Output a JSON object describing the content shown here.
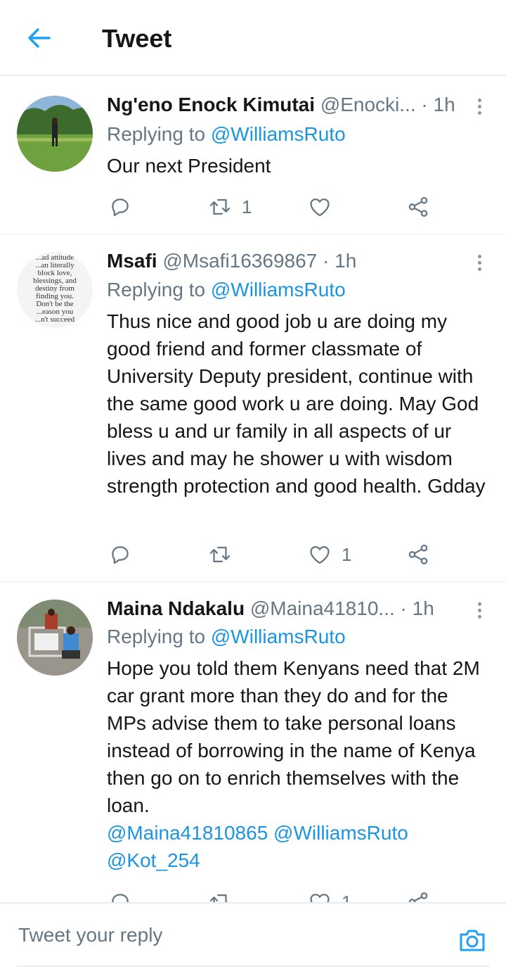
{
  "header": {
    "title": "Tweet"
  },
  "tweets": [
    {
      "name": "Ng'eno Enock Kimutai",
      "handle": "@Enocki...",
      "time": "· 1h",
      "reply_prefix": "Replying to ",
      "reply_handle": "@WilliamsRuto",
      "text": "Our next President",
      "retweet_count": "1",
      "like_count": ""
    },
    {
      "name": "Msafi",
      "handle": "@Msafi16369867",
      "time": "· 1h",
      "reply_prefix": "Replying to ",
      "reply_handle": "@WilliamsRuto",
      "text": "Thus nice and good job u are doing my good friend and former classmate of University Deputy president, continue with the same good work u are doing. May God bless u and ur family in all aspects of ur lives and may he shower u with wisdom strength protection and good health. Gdday",
      "retweet_count": "",
      "like_count": "1",
      "avatar_text": [
        "...ad attitude",
        "...an literally",
        "block love,",
        "blessings, and",
        "destiny from",
        "finding you.",
        "Don't be the",
        "...eason you",
        "...n't succeed"
      ]
    },
    {
      "name": "Maina Ndakalu",
      "handle": "@Maina41810...",
      "time": "· 1h",
      "reply_prefix": "Replying to ",
      "reply_handle": "@WilliamsRuto",
      "text": "Hope you told them Kenyans need that 2M car grant more than they do and for the MPs advise them to take personal loans instead of borrowing in the name of Kenya then go on to enrich themselves with the loan.",
      "mentions": [
        "@Maina41810865",
        "@WilliamsRuto",
        "@Kot_254"
      ],
      "retweet_count": "",
      "like_count": "1"
    }
  ],
  "reply_bar": {
    "placeholder": "Tweet your reply"
  },
  "colors": {
    "accent": "#1da1f2",
    "text": "#14171a",
    "muted": "#657786",
    "divider": "#e6ecf0"
  },
  "icons": [
    "back-arrow-icon",
    "more-icon",
    "reply-icon",
    "retweet-icon",
    "like-icon",
    "share-icon",
    "camera-icon"
  ]
}
